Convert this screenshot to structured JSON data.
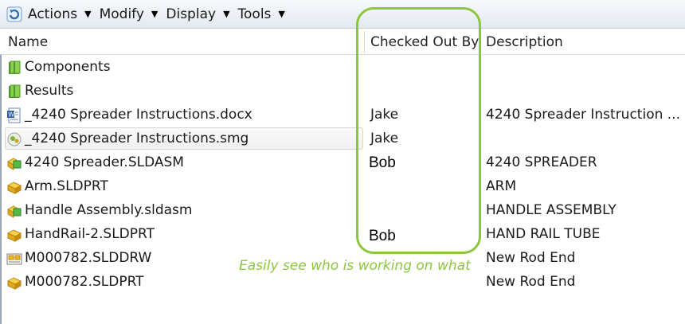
{
  "toolbar": {
    "menus": [
      {
        "label": "Actions"
      },
      {
        "label": "Modify"
      },
      {
        "label": "Display"
      },
      {
        "label": "Tools"
      }
    ]
  },
  "columns": {
    "name": "Name",
    "checked_out_by": "Checked Out By",
    "description": "Description"
  },
  "rows": [
    {
      "name": "Components",
      "checked": "",
      "desc": "",
      "icon": "folder-icon"
    },
    {
      "name": "Results",
      "checked": "",
      "desc": "",
      "icon": "folder-icon"
    },
    {
      "name": "_4240 Spreader Instructions.docx",
      "checked": "Jake",
      "desc": "4240 Spreader Instruction ...",
      "icon": "word-doc-icon"
    },
    {
      "name": "_4240 Spreader Instructions.smg",
      "checked": "Jake",
      "desc": "",
      "icon": "smg-file-icon"
    },
    {
      "name": "4240 Spreader.SLDASM",
      "checked": "",
      "desc": "4240 SPREADER",
      "icon": "assembly-icon"
    },
    {
      "name": "Arm.SLDPRT",
      "checked": "",
      "desc": "ARM",
      "icon": "part-icon"
    },
    {
      "name": "Handle Assembly.sldasm",
      "checked": "",
      "desc": "HANDLE ASSEMBLY",
      "icon": "assembly-icon"
    },
    {
      "name": "HandRail-2.SLDPRT",
      "checked": "",
      "desc": "HAND RAIL TUBE",
      "icon": "part-icon"
    },
    {
      "name": "M000782.SLDDRW",
      "checked": "",
      "desc": "New Rod End",
      "icon": "drawing-icon"
    },
    {
      "name": "M000782.SLDPRT",
      "checked": "",
      "desc": "New Rod End",
      "icon": "part-icon"
    }
  ],
  "overlay": {
    "bob_1": "Bob",
    "bob_2": "Bob",
    "annotation": "Easily see who is working on what"
  },
  "colors": {
    "highlight": "#8cc63f",
    "folder": "#6fb33f",
    "part": "#f2b51c",
    "assembly_green": "#55b947"
  }
}
